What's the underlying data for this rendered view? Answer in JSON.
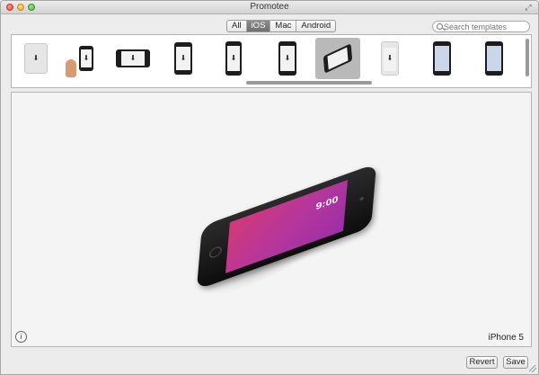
{
  "window": {
    "title": "Promotee"
  },
  "filters": {
    "all": "All",
    "ios": "iOS",
    "mac": "Mac",
    "android": "Android",
    "selected": "iOS"
  },
  "search": {
    "placeholder": "Search templates",
    "value": ""
  },
  "templates": {
    "count": 10,
    "selected_index": 6
  },
  "preview": {
    "device_name": "iPhone 5",
    "screen_time": "9:00"
  },
  "buttons": {
    "revert": "Revert",
    "save": "Save",
    "info": "i"
  },
  "colors": {
    "accent": "#7a7a7a",
    "screen_gradient_start": "#d23a78",
    "screen_gradient_end": "#9c2fa6"
  }
}
